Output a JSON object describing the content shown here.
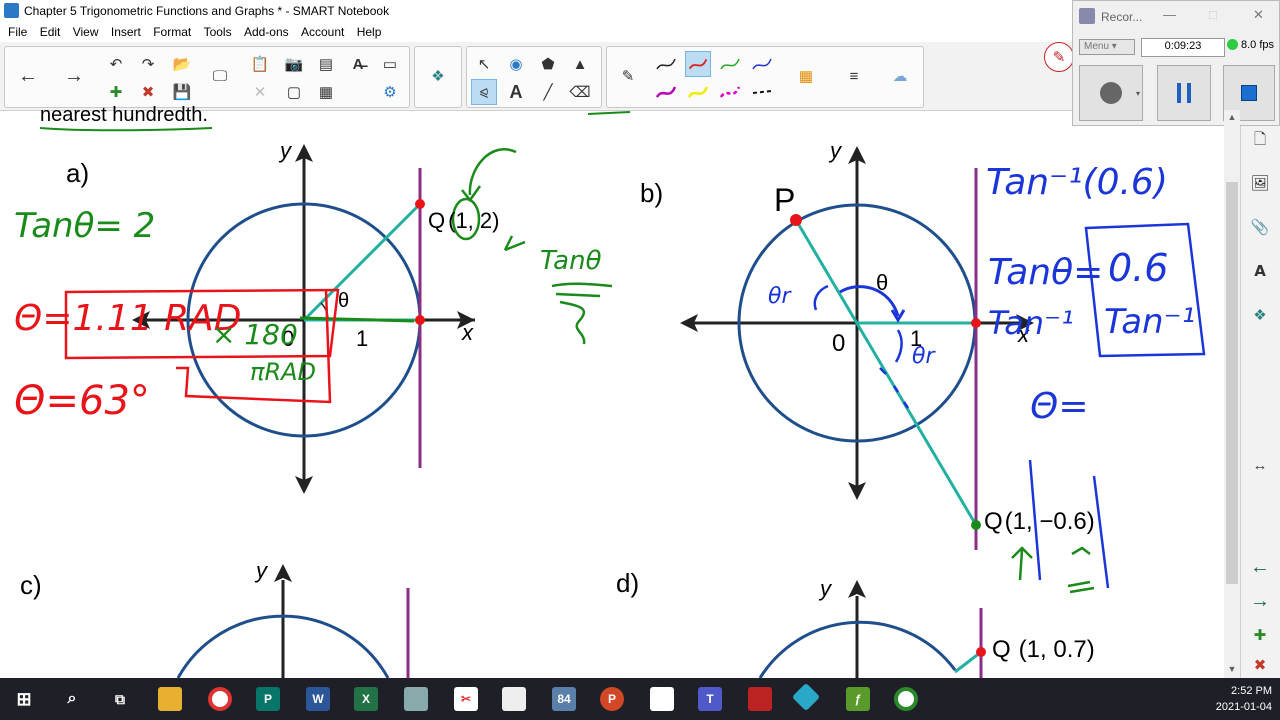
{
  "window": {
    "title": "Chapter 5 Trigonometric Functions and Graphs * - SMART Notebook"
  },
  "menu": [
    "File",
    "Edit",
    "View",
    "Insert",
    "Format",
    "Tools",
    "Add-ons",
    "Account",
    "Help"
  ],
  "recorder": {
    "title": "Recor...",
    "menu_label": "Menu",
    "elapsed": "0:09:23",
    "fps": "8.0 fps"
  },
  "page": {
    "top_fragment": "nearest hundredth.",
    "parts": {
      "a": {
        "label": "a)",
        "point": "Q",
        "point_coords": "(1, 2)",
        "origin": "0",
        "unit": "1",
        "axis_x": "x",
        "axis_y": "y",
        "angle": "θ"
      },
      "b": {
        "label": "b)",
        "point_p": "P",
        "point": "Q",
        "point_coords": "(1, −0.6)",
        "origin": "0",
        "unit": "1",
        "axis_x": "x",
        "axis_y": "y",
        "angle": "θ"
      },
      "c": {
        "label": "c)",
        "axis_y": "y"
      },
      "d": {
        "label": "d)",
        "point": "Q",
        "point_coords": "(1, 0.7)",
        "axis_y": "y"
      }
    },
    "ink": {
      "a_tan": "Tanθ= 2",
      "a_theta_rad": "Θ=1.11 RAD",
      "a_times": "× 180",
      "a_pi": "πRAD",
      "a_theta_deg": "Θ=63°",
      "a_note": "Tanθ",
      "b_inv_top": "Tan⁻¹(0.6)",
      "b_tan_eq": "Tanθ=",
      "b_box_val": "0.6",
      "b_box_inv": "Tan⁻¹",
      "b_tan_inv": "Tan⁻¹",
      "b_theta_eq": "Θ=",
      "b_theta_r": "θr"
    }
  },
  "taskbar": {
    "time": "2:52 PM",
    "date": "2021-01-04"
  },
  "colors": {
    "circle": "#1f4e8c",
    "tangent": "#8b2f86",
    "terminal": "#22b0a0",
    "red_ink": "#e8141a",
    "green_ink": "#1a8a1a",
    "blue_ink": "#1a35d8",
    "point": "#e8141a"
  }
}
